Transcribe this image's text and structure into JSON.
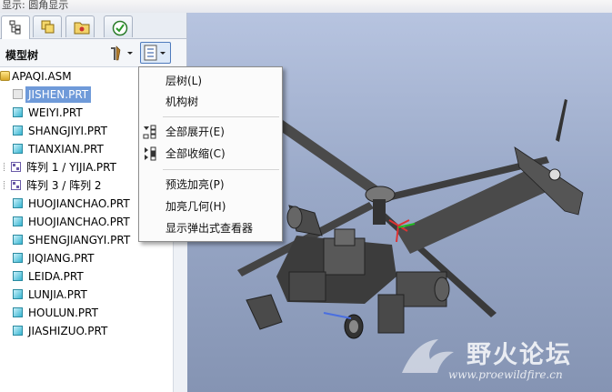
{
  "statusbar": {
    "text": "显示: 圆角显示"
  },
  "sidebar": {
    "tabs": [
      {
        "icon": "model-tree-icon"
      },
      {
        "icon": "layers-icon"
      },
      {
        "icon": "folder-icon"
      },
      {
        "icon": "favorites-icon"
      }
    ],
    "title": "模型树",
    "tools": [
      {
        "icon": "settings-tools-icon"
      },
      {
        "icon": "show-menu-icon"
      }
    ],
    "tree": [
      {
        "label": "APAQI.ASM",
        "icon": "assembly-icon"
      },
      {
        "label": "JISHEN.PRT",
        "icon": "part-icon",
        "selected": true
      },
      {
        "label": "WEIYI.PRT",
        "icon": "part-icon"
      },
      {
        "label": "SHANGJIYI.PRT",
        "icon": "part-icon"
      },
      {
        "label": "TIANXIAN.PRT",
        "icon": "part-icon"
      },
      {
        "label": "阵列 1 / YIJIA.PRT",
        "icon": "pattern-icon",
        "expandable": true
      },
      {
        "label": "阵列 3 / 阵列 2",
        "icon": "pattern-icon",
        "expandable": true
      },
      {
        "label": "HUOJIANCHAO.PRT",
        "icon": "part-icon"
      },
      {
        "label": "HUOJIANCHAO.PRT",
        "icon": "part-icon"
      },
      {
        "label": "SHENGJIANGYI.PRT",
        "icon": "part-icon"
      },
      {
        "label": "JIQIANG.PRT",
        "icon": "part-icon"
      },
      {
        "label": "LEIDA.PRT",
        "icon": "part-icon"
      },
      {
        "label": "LUNJIA.PRT",
        "icon": "part-icon"
      },
      {
        "label": "HOULUN.PRT",
        "icon": "part-icon"
      },
      {
        "label": "JIASHIZUO.PRT",
        "icon": "part-icon"
      }
    ]
  },
  "menu": {
    "items": [
      {
        "label": "层树(L)"
      },
      {
        "label": "机构树"
      },
      {
        "label": "全部展开(E)",
        "icon": "expand-all-icon"
      },
      {
        "label": "全部收缩(C)",
        "icon": "collapse-all-icon"
      },
      {
        "label": "预选加亮(P)"
      },
      {
        "label": "加亮几何(H)"
      },
      {
        "label": "显示弹出式查看器"
      }
    ]
  },
  "watermark": {
    "name": "野火论坛",
    "url": "www.proewildfire.cn"
  },
  "colors": {
    "selection": "#6f9ad9",
    "viewport": "#9aa9c8",
    "part_icon": "#37b5d1"
  }
}
